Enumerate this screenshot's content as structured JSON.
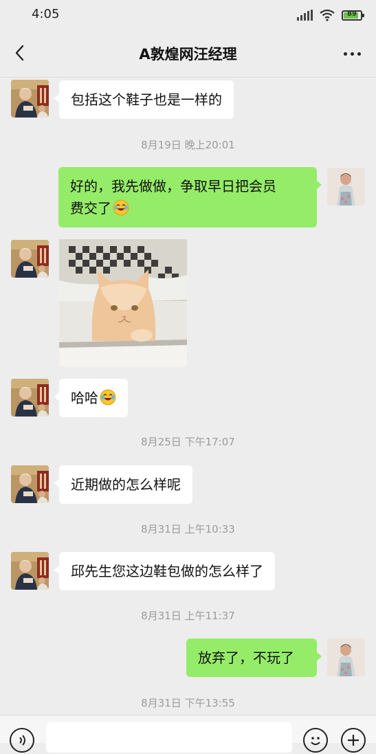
{
  "status_bar": {
    "time": "4:05",
    "battery": "89"
  },
  "header": {
    "title": "A敦煌网汪经理"
  },
  "messages": [
    {
      "side": "left",
      "text": "包括这个鞋子也是一样的"
    },
    {
      "time": "8月19日 晚上20:01"
    },
    {
      "side": "right",
      "line1": "好的，我先做做，争取早日把会员",
      "line2": "费交了",
      "emoji": "laughing-crying-emoji"
    },
    {
      "side": "left",
      "image": "cat-in-shoe-box-photo"
    },
    {
      "side": "left",
      "text": "哈哈",
      "emoji": "laughing-crying-emoji"
    },
    {
      "time": "8月25日 下午17:07"
    },
    {
      "side": "left",
      "text": "近期做的怎么样呢"
    },
    {
      "time": "8月31日 上午10:33"
    },
    {
      "side": "left",
      "text": "邱先生您这边鞋包做的怎么样了"
    },
    {
      "time": "8月31日 上午11:37"
    },
    {
      "side": "right",
      "text": "放弃了，不玩了"
    },
    {
      "time": "8月31日 下午13:55"
    }
  ],
  "icons": {
    "back": "chevron-left-icon",
    "more": "more-dots-icon",
    "voice": "voice-icon",
    "emoji": "emoji-icon",
    "plus": "plus-icon"
  },
  "colors": {
    "background": "#ededed",
    "sent_bubble": "#95ec69",
    "received_bubble": "#ffffff"
  }
}
